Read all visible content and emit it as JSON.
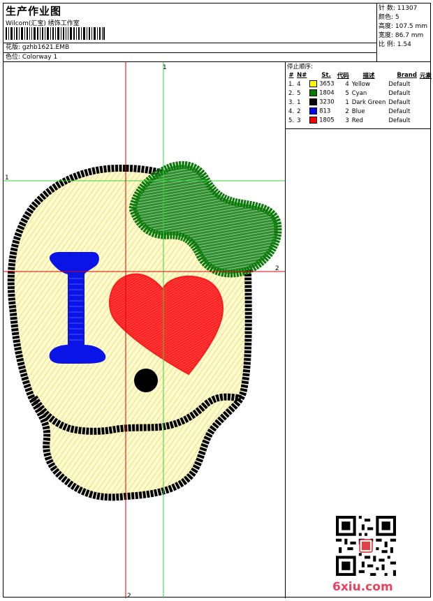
{
  "header": {
    "title": "生产作业图",
    "company": "Wilcom(汇宝) 绣饰工作室",
    "design_label": "花版: gzhb1621.EMB",
    "colorway_label": "色位: Colorway 1"
  },
  "stats": {
    "stitches": "针 数: 11307",
    "colors": "颜色: 5",
    "height": "高度: 107.5 mm",
    "width": "宽度: 86.7 mm",
    "scale": "比 例: 1.54"
  },
  "stop_sequence": {
    "title": "停止顺序:",
    "headers": [
      "#",
      "N#",
      "St.",
      "代码",
      "描述",
      "Brand",
      "元素"
    ],
    "rows": [
      {
        "idx": "1.",
        "n": "4",
        "color": "#ffff00",
        "st": "3653",
        "code": "4",
        "desc": "Yellow",
        "brand": "Default"
      },
      {
        "idx": "2.",
        "n": "5",
        "color": "#008000",
        "st": "1804",
        "code": "5",
        "desc": "Cyan",
        "brand": "Default"
      },
      {
        "idx": "3.",
        "n": "1",
        "color": "#000000",
        "st": "3230",
        "code": "1",
        "desc": "Dark Green",
        "brand": "Default"
      },
      {
        "idx": "4.",
        "n": "2",
        "color": "#0000ff",
        "st": "813",
        "code": "2",
        "desc": "Blue",
        "brand": "Default"
      },
      {
        "idx": "5.",
        "n": "3",
        "color": "#ff0000",
        "st": "1805",
        "code": "3",
        "desc": "Red",
        "brand": "Default"
      }
    ]
  },
  "guides": {
    "v1": "1",
    "v2": "2",
    "h1": "1",
    "h2": "2"
  },
  "seal_text": "6xiu.com",
  "colors": {
    "outline": "#000000",
    "fill": "#fff9c8",
    "hatch": "#e6d65a",
    "bow": "#0a7d0a",
    "heart": "#ff1a1a",
    "letter": "#0a14e6",
    "guide_red": "#e00000",
    "guide_green": "#00c000"
  }
}
